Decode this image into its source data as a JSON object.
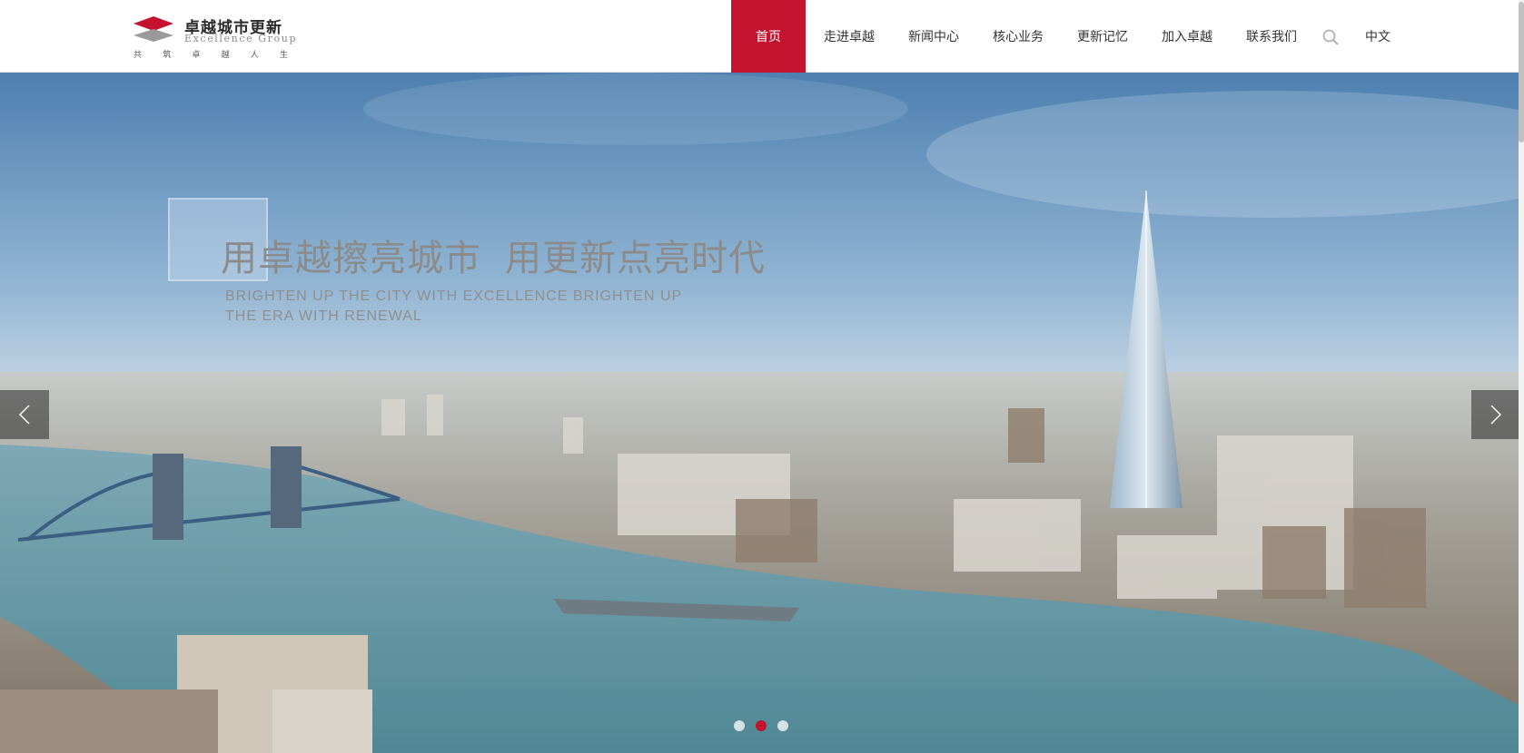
{
  "logo": {
    "name_cn": "卓越城市更新",
    "name_en": "Excellence Group",
    "slogan_chars": [
      "共",
      "筑",
      "卓",
      "越",
      "人",
      "生"
    ]
  },
  "nav": {
    "items": [
      {
        "label": "首页",
        "active": true
      },
      {
        "label": "走进卓越",
        "active": false
      },
      {
        "label": "新闻中心",
        "active": false
      },
      {
        "label": "核心业务",
        "active": false
      },
      {
        "label": "更新记忆",
        "active": false
      },
      {
        "label": "加入卓越",
        "active": false
      },
      {
        "label": "联系我们",
        "active": false
      }
    ],
    "search_icon": "search-icon",
    "language": "中文"
  },
  "hero": {
    "title_part1": "用卓越擦亮城市",
    "title_part2": "用更新点亮时代",
    "subtitle_line1": "BRIGHTEN UP THE CITY WITH EXCELLENCE BRIGHTEN UP",
    "subtitle_line2": "THE ERA WITH RENEWAL",
    "prev_icon": "chevron-left-icon",
    "next_icon": "chevron-right-icon",
    "slides_total": 3,
    "active_slide": 2
  },
  "colors": {
    "brand_red": "#c4122f",
    "nav_text": "#333333",
    "hero_text": "#8b8b8b"
  }
}
